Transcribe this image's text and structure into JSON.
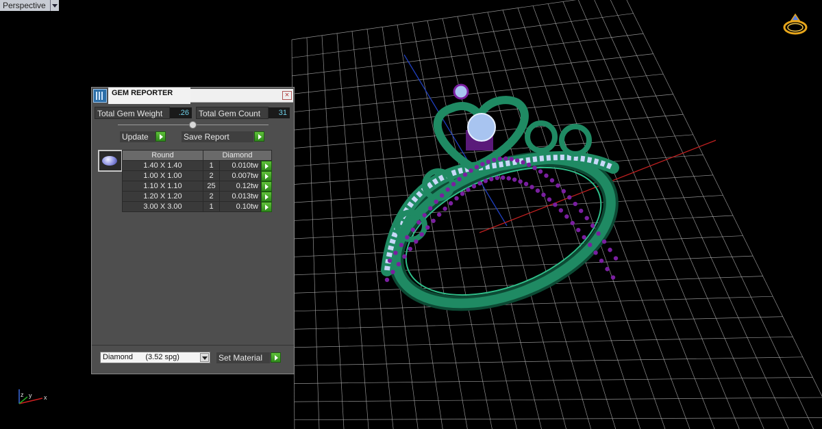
{
  "viewport": {
    "label": "Perspective",
    "grid_color": "#b8b8b8",
    "axis_x_color": "#c02020",
    "axis_y_color": "#2040c0",
    "metal_color": "#1f8a63",
    "gem_color": "#a8c4f0",
    "prong_color": "#7a1fa0"
  },
  "gem_reporter": {
    "title": "GEM REPORTER",
    "close_glyph": "×",
    "total_weight_label": "Total Gem Weight",
    "total_weight_value": ".26",
    "total_count_label": "Total Gem Count",
    "total_count_value": "31",
    "update_label": "Update",
    "save_report_label": "Save Report",
    "table": {
      "headers": [
        "Round",
        "Diamond"
      ],
      "rows": [
        {
          "size": "1.40 X 1.40",
          "count": "1",
          "weight": "0.010tw"
        },
        {
          "size": "1.00 X 1.00",
          "count": "2",
          "weight": "0.007tw"
        },
        {
          "size": "1.10 X 1.10",
          "count": "25",
          "weight": "0.12tw"
        },
        {
          "size": "1.20 X 1.20",
          "count": "2",
          "weight": "0.013tw"
        },
        {
          "size": "3.00 X 3.00",
          "count": "1",
          "weight": "0.10tw"
        }
      ]
    },
    "material_select": "Diamond      (3.52 spg)",
    "set_material_label": "Set Material",
    "accent_green": "#3fa82a"
  },
  "icons": {
    "ring_icon": "ring-icon",
    "axis_icon": "axis-gizmo-icon"
  },
  "axis_gizmo": {
    "x": "x",
    "y": "y",
    "z": "z"
  }
}
